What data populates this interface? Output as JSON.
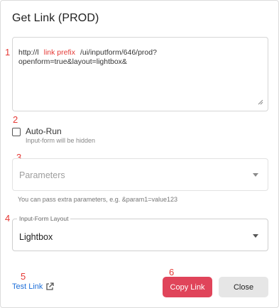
{
  "dialog": {
    "title": "Get Link (PROD)"
  },
  "markers": [
    "1",
    "2",
    "3",
    "4",
    "5",
    "6"
  ],
  "url_field": {
    "line1_start": "http://l",
    "prefix_label": "link prefix",
    "line1_end": "/ui/inputform/646/prod?",
    "line2": "openform=true&layout=lightbox&"
  },
  "auto_run": {
    "label": "Auto-Run",
    "hint": "Input-form will be hidden",
    "checked": false
  },
  "parameters": {
    "placeholder": "Parameters",
    "helper": "You can pass extra parameters, e.g. &param1=value123"
  },
  "layout_select": {
    "legend": "Input-Form Layout",
    "value": "Lightbox"
  },
  "actions": {
    "test_link": "Test Link",
    "copy_link": "Copy Link",
    "close": "Close"
  },
  "colors": {
    "accent": "#e0445a",
    "link": "#1e6fd9",
    "marker": "#e53935"
  },
  "icons": {
    "external_link": "external-link-icon",
    "dropdown": "chevron-down-icon"
  }
}
